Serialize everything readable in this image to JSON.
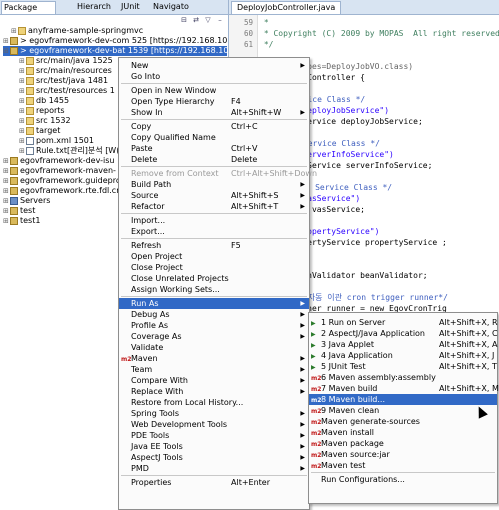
{
  "left_tabs": [
    "Package",
    "Hierarch",
    "JUnit",
    "Navigato"
  ],
  "tree": [
    {
      "indent": 1,
      "icon": "folder",
      "text": "anyframe-sample-springmvc",
      "sel": false
    },
    {
      "indent": 0,
      "icon": "proj",
      "text": "> egovframework-dev-com 525 [https://192.168.100.143",
      "sel": false
    },
    {
      "indent": 0,
      "icon": "proj",
      "text": "> egovframework-dev-bat 1539 [https://192.168.100.143",
      "sel": true
    },
    {
      "indent": 2,
      "icon": "folder",
      "text": "src/main/java 1525",
      "sel": false
    },
    {
      "indent": 2,
      "icon": "folder",
      "text": "src/main/resources",
      "sel": false
    },
    {
      "indent": 2,
      "icon": "folder",
      "text": "src/test/java 1481",
      "sel": false
    },
    {
      "indent": 2,
      "icon": "folder",
      "text": "src/test/resources 1",
      "sel": false
    },
    {
      "indent": 2,
      "icon": "folder",
      "text": "db 1455",
      "sel": false
    },
    {
      "indent": 2,
      "icon": "folder",
      "text": "reports",
      "sel": false
    },
    {
      "indent": 2,
      "icon": "folder",
      "text": "src 1532",
      "sel": false
    },
    {
      "indent": 2,
      "icon": "folder",
      "text": "target",
      "sel": false
    },
    {
      "indent": 2,
      "icon": "file",
      "text": "pom.xml 1501",
      "sel": false
    },
    {
      "indent": 2,
      "icon": "file",
      "text": "Rule.txt[관리]분석 [W(발",
      "sel": false
    },
    {
      "indent": 0,
      "icon": "proj",
      "text": "egovframework-dev-isu",
      "sel": false
    },
    {
      "indent": 0,
      "icon": "proj",
      "text": "egovframework-maven-",
      "sel": false
    },
    {
      "indent": 0,
      "icon": "proj",
      "text": "egovframework.guideprog",
      "sel": false
    },
    {
      "indent": 0,
      "icon": "proj",
      "text": "egovframework.rte.fdl.cmm",
      "sel": false
    },
    {
      "indent": 0,
      "icon": "srv",
      "text": "Servers",
      "sel": false
    },
    {
      "indent": 0,
      "icon": "proj",
      "text": "test",
      "sel": false
    },
    {
      "indent": 0,
      "icon": "proj",
      "text": "test1",
      "sel": false
    }
  ],
  "editor": {
    "tab_title": "DeployJobController.java",
    "lines": [
      {
        "n": "59",
        "text": " *",
        "cls": "cm"
      },
      {
        "n": "60",
        "text": " * Copyright (C) 2009 by MOPAS  All right reserved.",
        "cls": "cm"
      },
      {
        "n": "61",
        "text": " */",
        "cls": "cm"
      },
      {
        "n": "",
        "text": "",
        "cls": ""
      },
      {
        "n": "",
        "text": "ributes(types=DeployJobVO.class)",
        "cls": "ann"
      },
      {
        "n": "",
        "text": " DeployJobController {",
        "cls": ""
      },
      {
        "n": "",
        "text": "",
        "cls": ""
      },
      {
        "n": "",
        "text": "**관리 Service Class */",
        "cls": "cmt"
      },
      {
        "n": "",
        "text": "(name = \"deployJobService\")",
        "cls": "str"
      },
      {
        "n": "",
        "text": "DeployJobService deployJobService;",
        "cls": ""
      },
      {
        "n": "",
        "text": "",
        "cls": ""
      },
      {
        "n": "",
        "text": "**서버정보 Service Class */",
        "cls": "cmt"
      },
      {
        "n": "",
        "text": "(name = \"serverInfoService\")",
        "cls": "str"
      },
      {
        "n": "",
        "text": "ServerInfoService serverInfoService;",
        "cls": ""
      },
      {
        "n": "",
        "text": "",
        "cls": ""
      },
      {
        "n": "",
        "text": "**서비스 정보 Service Class */",
        "cls": "cmt"
      },
      {
        "n": "",
        "text": "(name = \"vasService\")",
        "cls": "str"
      },
      {
        "n": "",
        "text": "VasService vasService;",
        "cls": ""
      },
      {
        "n": "",
        "text": "",
        "cls": ""
      },
      {
        "n": "",
        "text": "e(name=\"propertyService\")",
        "cls": "str"
      },
      {
        "n": "",
        "text": "d EgovPropertyService propertyService ;",
        "cls": ""
      },
      {
        "n": "",
        "text": "",
        "cls": ""
      },
      {
        "n": "",
        "text": "ed",
        "cls": "ann"
      },
      {
        "n": "",
        "text": "DefaultBeanValidator beanValidator;",
        "cls": ""
      },
      {
        "n": "",
        "text": "",
        "cls": ""
      },
      {
        "n": "",
        "text": "**배치 작업 자동 이관 cron trigger runner*/",
        "cls": "cmt"
      },
      {
        "n": "",
        "text": "TriggerRunner runner = new EgovCronTrig",
        "cls": ""
      }
    ]
  },
  "context_menu": {
    "items": [
      {
        "label": "New",
        "shortcut": "",
        "arrow": true,
        "disabled": false
      },
      {
        "label": "Go Into",
        "shortcut": "",
        "arrow": false,
        "disabled": false
      },
      {
        "sep": true
      },
      {
        "label": "Open in New Window",
        "shortcut": "",
        "arrow": false,
        "disabled": false
      },
      {
        "label": "Open Type Hierarchy",
        "shortcut": "F4",
        "arrow": false,
        "disabled": false
      },
      {
        "label": "Show In",
        "shortcut": "Alt+Shift+W",
        "arrow": true,
        "disabled": false
      },
      {
        "sep": true
      },
      {
        "label": "Copy",
        "shortcut": "Ctrl+C",
        "arrow": false,
        "disabled": false
      },
      {
        "label": "Copy Qualified Name",
        "shortcut": "",
        "arrow": false,
        "disabled": false
      },
      {
        "label": "Paste",
        "shortcut": "Ctrl+V",
        "arrow": false,
        "disabled": false
      },
      {
        "label": "Delete",
        "shortcut": "Delete",
        "arrow": false,
        "disabled": false
      },
      {
        "sep": true
      },
      {
        "label": "Remove from Context",
        "shortcut": "Ctrl+Alt+Shift+Down",
        "arrow": false,
        "disabled": true
      },
      {
        "label": "Build Path",
        "shortcut": "",
        "arrow": true,
        "disabled": false
      },
      {
        "label": "Source",
        "shortcut": "Alt+Shift+S",
        "arrow": true,
        "disabled": false
      },
      {
        "label": "Refactor",
        "shortcut": "Alt+Shift+T",
        "arrow": true,
        "disabled": false
      },
      {
        "sep": true
      },
      {
        "label": "Import...",
        "shortcut": "",
        "arrow": false,
        "disabled": false
      },
      {
        "label": "Export...",
        "shortcut": "",
        "arrow": false,
        "disabled": false
      },
      {
        "sep": true
      },
      {
        "label": "Refresh",
        "shortcut": "F5",
        "arrow": false,
        "disabled": false
      },
      {
        "label": "Open Project",
        "shortcut": "",
        "arrow": false,
        "disabled": false
      },
      {
        "label": "Close Project",
        "shortcut": "",
        "arrow": false,
        "disabled": false
      },
      {
        "label": "Close Unrelated Projects",
        "shortcut": "",
        "arrow": false,
        "disabled": false
      },
      {
        "label": "Assign Working Sets...",
        "shortcut": "",
        "arrow": false,
        "disabled": false
      },
      {
        "sep": true
      },
      {
        "label": "Run As",
        "shortcut": "",
        "arrow": true,
        "disabled": false,
        "hl": true
      },
      {
        "label": "Debug As",
        "shortcut": "",
        "arrow": true,
        "disabled": false
      },
      {
        "label": "Profile As",
        "shortcut": "",
        "arrow": true,
        "disabled": false
      },
      {
        "label": "Coverage As",
        "shortcut": "",
        "arrow": true,
        "disabled": false
      },
      {
        "label": "Validate",
        "shortcut": "",
        "arrow": false,
        "disabled": false
      },
      {
        "label": "Maven",
        "shortcut": "",
        "arrow": true,
        "disabled": false,
        "icon": "m2"
      },
      {
        "label": "Team",
        "shortcut": "",
        "arrow": true,
        "disabled": false
      },
      {
        "label": "Compare With",
        "shortcut": "",
        "arrow": true,
        "disabled": false
      },
      {
        "label": "Replace With",
        "shortcut": "",
        "arrow": true,
        "disabled": false
      },
      {
        "label": "Restore from Local History...",
        "shortcut": "",
        "arrow": false,
        "disabled": false
      },
      {
        "label": "Spring Tools",
        "shortcut": "",
        "arrow": true,
        "disabled": false
      },
      {
        "label": "Web Development Tools",
        "shortcut": "",
        "arrow": true,
        "disabled": false
      },
      {
        "label": "PDE Tools",
        "shortcut": "",
        "arrow": true,
        "disabled": false
      },
      {
        "label": "Java EE Tools",
        "shortcut": "",
        "arrow": true,
        "disabled": false
      },
      {
        "label": "AspectJ Tools",
        "shortcut": "",
        "arrow": true,
        "disabled": false
      },
      {
        "label": "PMD",
        "shortcut": "",
        "arrow": true,
        "disabled": false
      },
      {
        "sep": true
      },
      {
        "label": "Properties",
        "shortcut": "Alt+Enter",
        "arrow": false,
        "disabled": false
      }
    ]
  },
  "run_as_menu": {
    "items": [
      {
        "label": "1 Run on Server",
        "shortcut": "Alt+Shift+X, R",
        "icon": "run"
      },
      {
        "label": "2 AspectJ/Java Application",
        "shortcut": "Alt+Shift+X, C",
        "icon": "run"
      },
      {
        "label": "3 Java Applet",
        "shortcut": "Alt+Shift+X, A",
        "icon": "run"
      },
      {
        "label": "4 Java Application",
        "shortcut": "Alt+Shift+X, J",
        "icon": "run"
      },
      {
        "label": "5 JUnit Test",
        "shortcut": "Alt+Shift+X, T",
        "icon": "run"
      },
      {
        "label": "6 Maven assembly:assembly",
        "shortcut": "",
        "icon": "m2"
      },
      {
        "label": "7 Maven build",
        "shortcut": "Alt+Shift+X, M",
        "icon": "m2"
      },
      {
        "label": "8 Maven build...",
        "shortcut": "",
        "icon": "m2",
        "hl": true
      },
      {
        "label": "9 Maven clean",
        "shortcut": "",
        "icon": "m2"
      },
      {
        "label": "Maven generate-sources",
        "shortcut": "",
        "icon": "m2"
      },
      {
        "label": "Maven install",
        "shortcut": "",
        "icon": "m2"
      },
      {
        "label": "Maven package",
        "shortcut": "",
        "icon": "m2"
      },
      {
        "label": "Maven source:jar",
        "shortcut": "",
        "icon": "m2"
      },
      {
        "label": "Maven test",
        "shortcut": "",
        "icon": "m2"
      },
      {
        "sep": true
      },
      {
        "label": "Run Configurations...",
        "shortcut": "",
        "icon": ""
      }
    ]
  },
  "colors": {
    "selection": "#3169c6",
    "maven_icon": "#c01818"
  }
}
